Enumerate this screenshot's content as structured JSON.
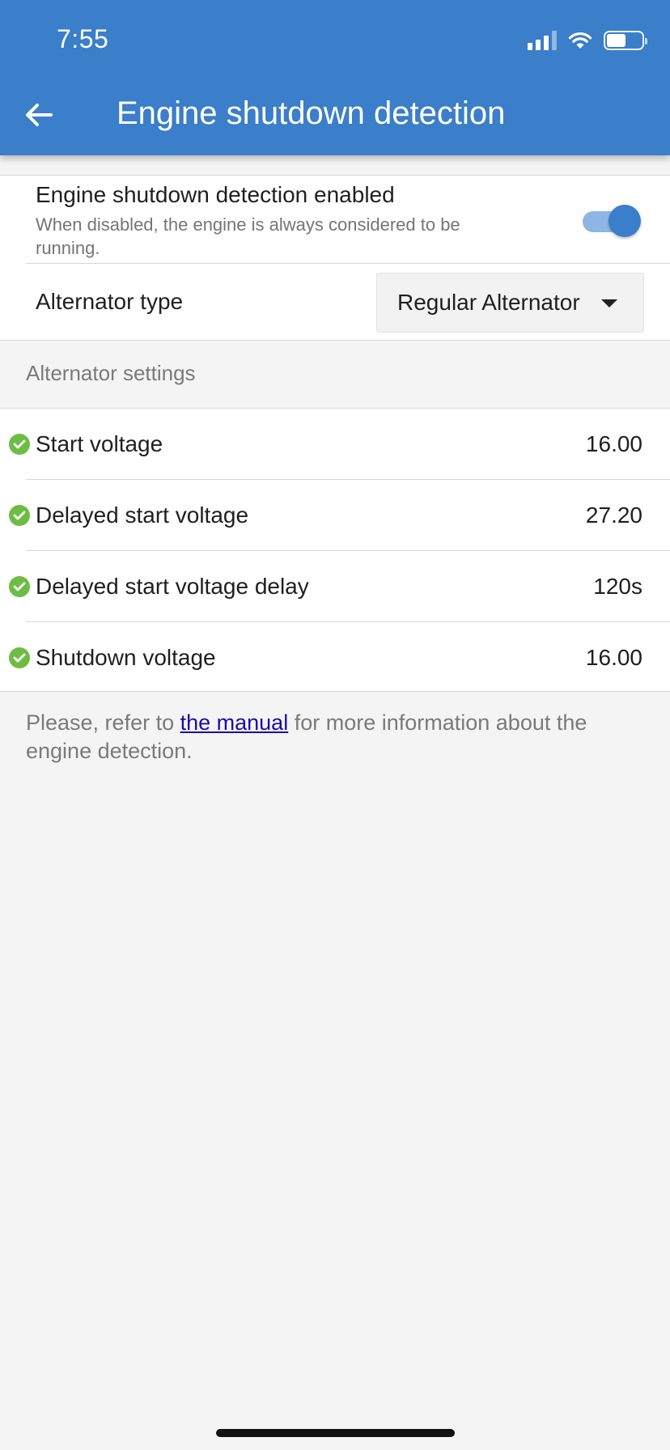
{
  "status_bar": {
    "time": "7:55",
    "battery_level": 0.55
  },
  "header": {
    "title": "Engine shutdown detection",
    "back_icon": "arrow-left-icon",
    "background_color": "#3b7ec9"
  },
  "engine_detection": {
    "title": "Engine shutdown detection enabled",
    "description": "When disabled, the engine is always considered to be running.",
    "enabled": true
  },
  "alternator": {
    "label": "Alternator type",
    "selected": "Regular Alternator"
  },
  "section": {
    "title": "Alternator settings"
  },
  "settings": [
    {
      "label": "Start voltage",
      "value": "16.00"
    },
    {
      "label": "Delayed start voltage",
      "value": "27.20"
    },
    {
      "label": "Delayed start voltage delay",
      "value": "120s"
    },
    {
      "label": "Shutdown voltage",
      "value": "16.00"
    }
  ],
  "footnote": {
    "prefix": "Please, refer to ",
    "link": "the manual",
    "suffix": " for more information about the engine detection."
  }
}
